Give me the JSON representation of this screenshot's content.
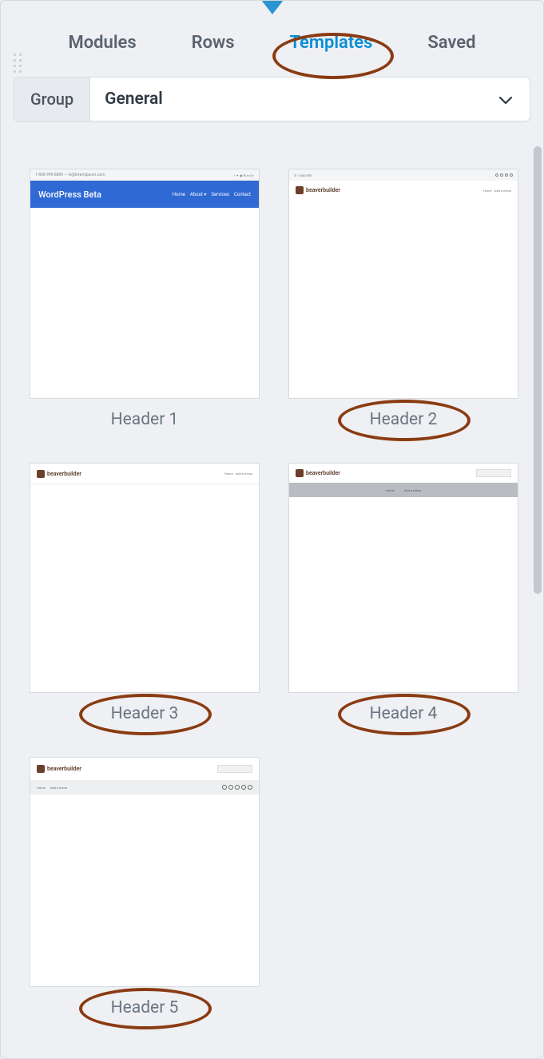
{
  "tabs": {
    "modules": "Modules",
    "rows": "Rows",
    "templates": "Templates",
    "saved": "Saved",
    "active": "templates"
  },
  "group": {
    "label": "Group",
    "value": "General"
  },
  "templates": [
    {
      "label": "Header 1",
      "annotated": false
    },
    {
      "label": "Header 2",
      "annotated": true
    },
    {
      "label": "Header 3",
      "annotated": true
    },
    {
      "label": "Header 4",
      "annotated": true
    },
    {
      "label": "Header 5",
      "annotated": true
    }
  ],
  "thumb1": {
    "topbar_left": "1-800-999-8889  —  hi@loremipsum.com",
    "brand": "WordPress Beta",
    "menu": [
      "Home",
      "About ▾",
      "Services",
      "Contact"
    ]
  },
  "thumb2": {
    "logo_text": "beaverbuilder",
    "menu": [
      "Home",
      "Add a menu"
    ]
  },
  "thumb3": {
    "logo_text": "beaverbuilder",
    "menu": [
      "Home",
      "Add a menu"
    ]
  },
  "thumb4": {
    "logo_text": "beaverbuilder",
    "menu": [
      "Home",
      "Add a menu"
    ]
  },
  "thumb5": {
    "logo_text": "beaverbuilder",
    "menu": [
      "Home",
      "Add a menu"
    ]
  }
}
